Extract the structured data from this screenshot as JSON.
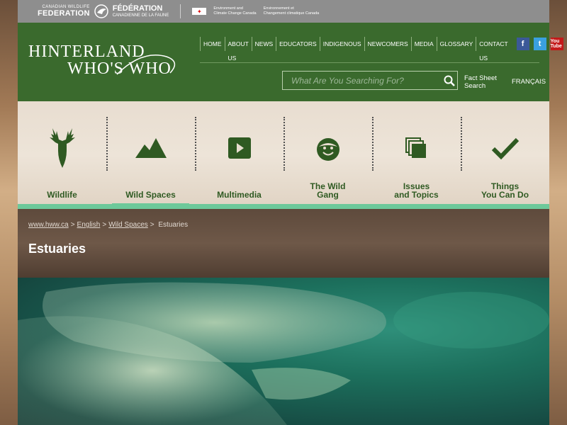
{
  "govbar": {
    "cwf_en_small": "CANADIAN WILDLIFE",
    "cwf_en_big": "FEDERATION",
    "cwf_fr_big": "FÉDÉRATION",
    "cwf_fr_small": "CANADIENNE DE LA FAUNE",
    "eccc_en": "Environment and\nClimate Change Canada",
    "eccc_fr": "Environnement et\nChangement climatique Canada"
  },
  "logo": {
    "line1": "HINTERLAND",
    "line2": "WHO'S WHO"
  },
  "topnav": [
    "HOME",
    "ABOUT US",
    "NEWS",
    "EDUCATORS",
    "INDIGENOUS",
    "NEWCOMERS",
    "MEDIA",
    "GLOSSARY",
    "CONTACT US"
  ],
  "social": {
    "facebook": "f",
    "twitter": "t",
    "youtube": "You Tube"
  },
  "search": {
    "placeholder": "What Are You Searching For?"
  },
  "factsheet": {
    "line1": "Fact Sheet",
    "line2": "Search"
  },
  "lang": "FRANÇAIS",
  "mainnav": [
    {
      "line1": "",
      "line2": "Wildlife",
      "icon": "deer-icon"
    },
    {
      "line1": "",
      "line2": "Wild Spaces",
      "icon": "mountain-icon"
    },
    {
      "line1": "",
      "line2": "Multimedia",
      "icon": "play-icon"
    },
    {
      "line1": "The Wild",
      "line2": "Gang",
      "icon": "face-icon"
    },
    {
      "line1": "Issues",
      "line2": "and Topics",
      "icon": "pages-icon"
    },
    {
      "line1": "Things",
      "line2": "You Can Do",
      "icon": "check-icon"
    }
  ],
  "breadcrumb": {
    "home": "www.hww.ca",
    "english": "English",
    "wild": "Wild Spaces",
    "current": "Estuaries"
  },
  "page_title": "Estuaries",
  "colors": {
    "header_green": "#3a6a2d",
    "nav_text": "#2f5a22",
    "active_bar": "#6dc99a"
  }
}
